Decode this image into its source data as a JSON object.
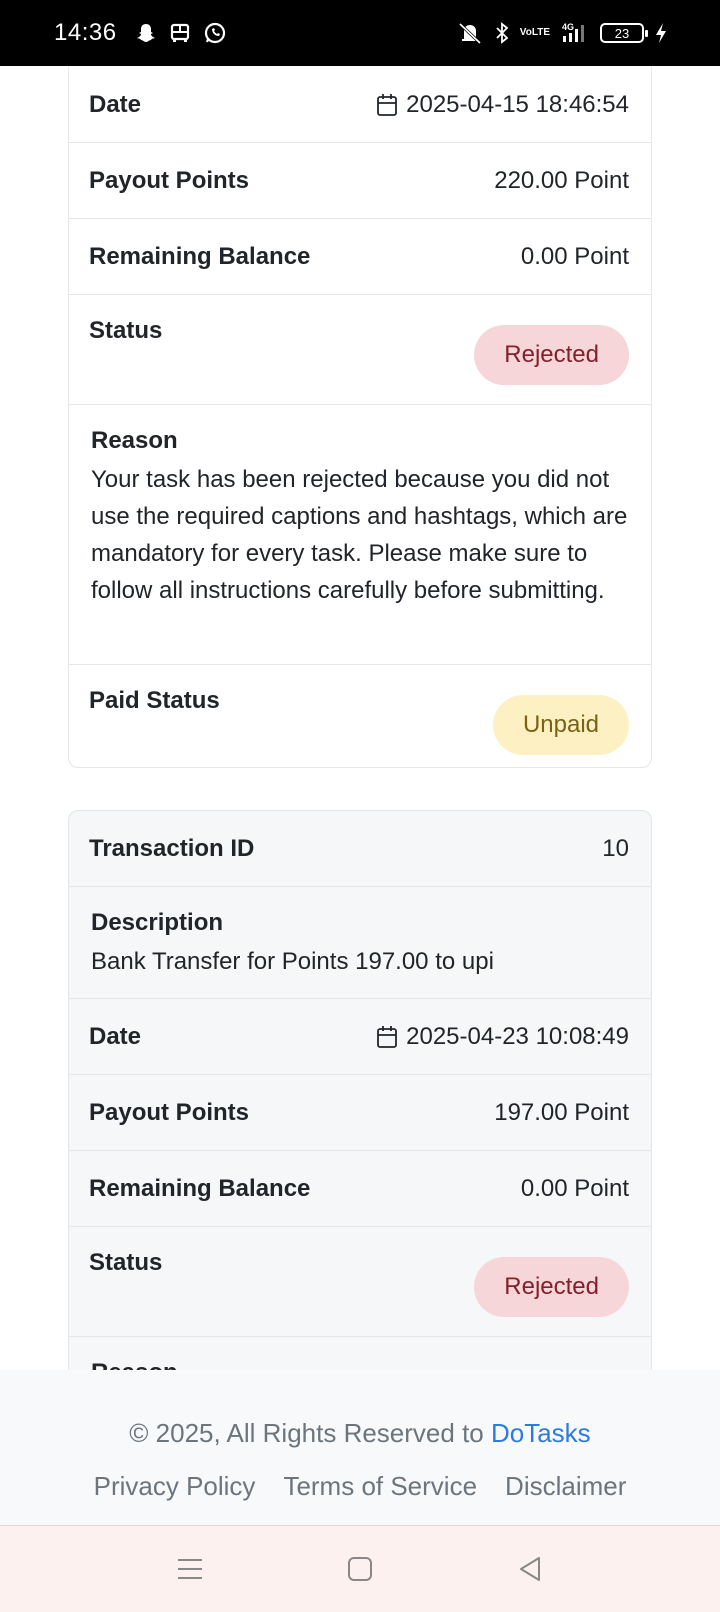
{
  "status_bar": {
    "time": "14:36",
    "battery": "23",
    "left_icons": [
      "snapchat-icon",
      "bus-icon",
      "whatsapp-icon"
    ],
    "right_icons": [
      "mute-icon",
      "bluetooth-icon",
      "volte-icon",
      "signal-4g-icon",
      "battery-icon",
      "charging-icon"
    ],
    "volte_top": "Vo",
    "volte_bottom": "LTE"
  },
  "card1": {
    "date_label": "Date",
    "date_value": "2025-04-15 18:46:54",
    "payout_label": "Payout Points",
    "payout_value": "220.00 Point",
    "balance_label": "Remaining Balance",
    "balance_value": "0.00 Point",
    "status_label": "Status",
    "status_value": "Rejected",
    "reason_label": "Reason",
    "reason_text": "Your task has been rejected because you did not use the required captions and hashtags, which are mandatory for every task. Please make sure to follow all instructions carefully before submitting.",
    "paid_label": "Paid Status",
    "paid_value": "Unpaid"
  },
  "card2": {
    "txn_label": "Transaction ID",
    "txn_value": "10",
    "desc_label": "Description",
    "desc_text": "Bank Transfer for Points 197.00 to upi",
    "date_label": "Date",
    "date_value": "2025-04-23 10:08:49",
    "payout_label": "Payout Points",
    "payout_value": "197.00 Point",
    "balance_label": "Remaining Balance",
    "balance_value": "0.00 Point",
    "status_label": "Status",
    "status_value": "Rejected",
    "reason_label": "Reason"
  },
  "footer": {
    "copyright": "© 2025, All Rights Reserved to ",
    "brand": "DoTasks",
    "links": [
      "Privacy Policy",
      "Terms of Service",
      "Disclaimer"
    ]
  },
  "colors": {
    "brand_link": "#2d7be0",
    "rejected_bg": "#f7d6da",
    "rejected_text": "#842029",
    "unpaid_bg": "#fdf1c4",
    "unpaid_text": "#7a6212"
  },
  "navbar": {
    "buttons": [
      "menu-icon",
      "home-icon",
      "back-icon"
    ]
  }
}
